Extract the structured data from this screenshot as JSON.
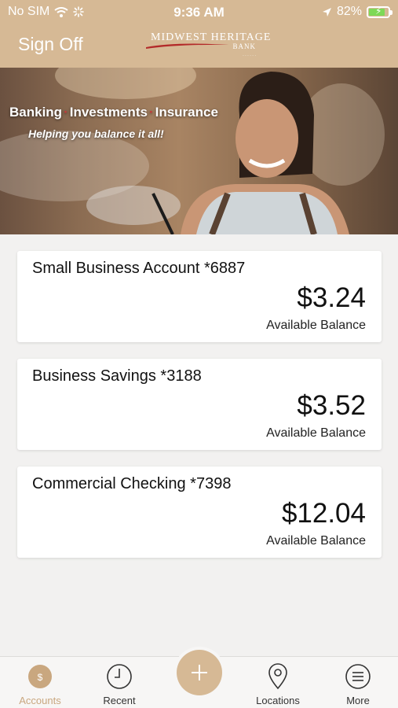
{
  "status_bar": {
    "carrier": "No SIM",
    "time": "9:36 AM",
    "battery": "82%"
  },
  "header": {
    "sign_off_label": "Sign Off",
    "logo_line1": "MIDWEST HERITAGE",
    "logo_line2": "BANK"
  },
  "hero": {
    "title_part1": "Banking",
    "title_part2": "Investments",
    "title_part3": "Insurance",
    "subtitle": "Helping you balance it all!"
  },
  "accounts": [
    {
      "name": "Small Business Account *6887",
      "balance": "$3.24",
      "balance_label": "Available Balance"
    },
    {
      "name": "Business Savings *3188",
      "balance": "$3.52",
      "balance_label": "Available Balance"
    },
    {
      "name": "Commercial Checking *7398",
      "balance": "$12.04",
      "balance_label": "Available Balance"
    }
  ],
  "tabs": [
    {
      "label": "Accounts",
      "icon": "accounts-icon",
      "active": true
    },
    {
      "label": "Recent",
      "icon": "clock-icon"
    },
    {
      "label": "Locations",
      "icon": "location-pin-icon"
    },
    {
      "label": "More",
      "icon": "menu-icon"
    }
  ],
  "colors": {
    "brand": "#d6b995",
    "accent_active": "#c9a77f",
    "logo_swoosh": "#b32a2a"
  }
}
